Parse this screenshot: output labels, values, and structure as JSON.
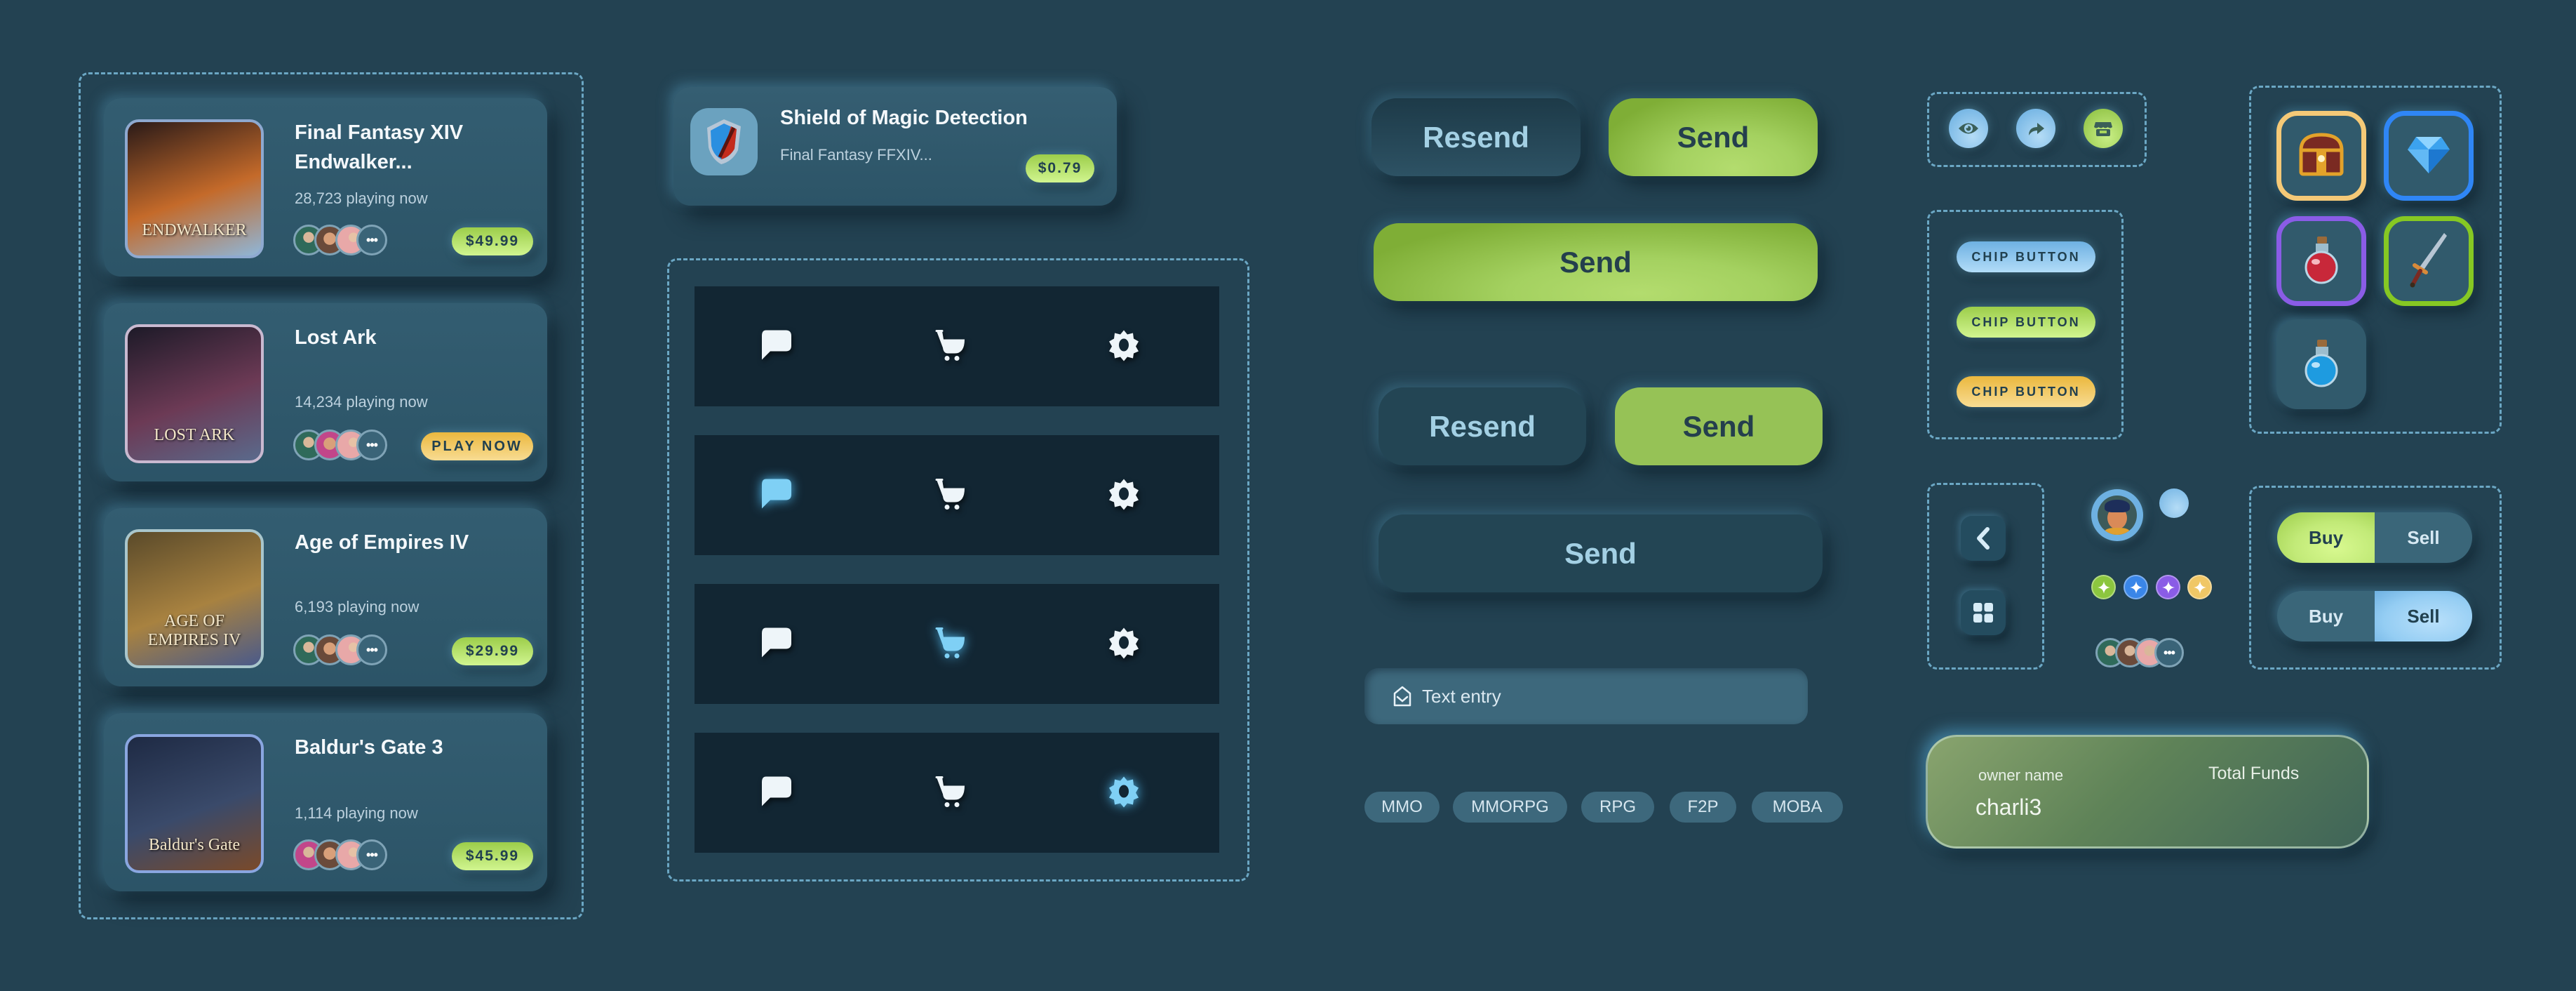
{
  "games": [
    {
      "title": "Final Fantasy XIV Endwalker...",
      "players": "28,723 playing now",
      "action": "$49.99",
      "action_type": "price",
      "thumb_caption": "ENDWALKER",
      "thumb_colors": [
        "#2a1a18",
        "#c46a2a",
        "#8fb6d8"
      ],
      "frame_color": "#8ea9d0"
    },
    {
      "title": "Lost Ark",
      "players": "14,234 playing now",
      "action": "PLAY NOW",
      "action_type": "play",
      "thumb_caption": "LOST ARK",
      "thumb_colors": [
        "#1d1a28",
        "#6c3a55",
        "#5a6a8c"
      ],
      "frame_color": "#c9b9d0"
    },
    {
      "title": "Age of Empires IV",
      "players": "6,193 playing now",
      "action": "$29.99",
      "action_type": "price",
      "thumb_caption": "AGE OF EMPIRES IV",
      "thumb_colors": [
        "#5a4a2a",
        "#a88240",
        "#4a5a8a"
      ],
      "frame_color": "#a9c6cc"
    },
    {
      "title": "Baldur's Gate 3",
      "players": "1,114 playing now",
      "action": "$45.99",
      "action_type": "price",
      "thumb_caption": "Baldur's Gate",
      "thumb_colors": [
        "#1e2a44",
        "#3a4a6a",
        "#7a4a2a"
      ],
      "frame_color": "#8aa6e0"
    }
  ],
  "item_card": {
    "title": "Shield of Magic Detection",
    "subtitle": "Final Fantasy FFXIV...",
    "price": "$0.79"
  },
  "nav_bars": {
    "icons": [
      "chat-icon",
      "cart-icon",
      "settings-icon"
    ],
    "rows_active_index": [
      null,
      0,
      1,
      2
    ],
    "active_color": "#7fd0f5",
    "inactive_color": "#eef5f9"
  },
  "buttons": {
    "resend": "Resend",
    "send": "Send"
  },
  "text_entry": {
    "placeholder": "Text entry",
    "value": ""
  },
  "tags": [
    "MMO",
    "MMORPG",
    "RPG",
    "F2P",
    "MOBA"
  ],
  "icon_buttons": [
    "eye-icon",
    "share-icon",
    "store-icon"
  ],
  "chips": [
    {
      "label": "CHIP BUTTON",
      "color": "blue"
    },
    {
      "label": "CHIP BUTTON",
      "color": "green"
    },
    {
      "label": "CHIP BUTTON",
      "color": "yellow"
    }
  ],
  "small_nav": [
    "chevron-left-icon",
    "grid-icon"
  ],
  "badges": [
    {
      "color": "#8cc63f"
    },
    {
      "color": "#3a86e8"
    },
    {
      "color": "#8a5ce6"
    },
    {
      "color": "#f0c766"
    }
  ],
  "inventory": [
    {
      "name": "treasure-chest",
      "border": "#f5c977"
    },
    {
      "name": "diamond",
      "border": "#2f86f6"
    },
    {
      "name": "red-potion",
      "border": "#8a5ce6"
    },
    {
      "name": "sword",
      "border": "#86c823"
    },
    {
      "name": "blue-potion",
      "border": null
    }
  ],
  "trade_toggles": [
    {
      "buy": "Buy",
      "sell": "Sell",
      "selected": "buy"
    },
    {
      "buy": "Buy",
      "sell": "Sell",
      "selected": "sell"
    }
  ],
  "owner_card": {
    "owner_label": "owner name",
    "owner_value": "charli3",
    "funds_label": "Total Funds"
  },
  "colors": {
    "background": "#234252",
    "accent_green": "#9ccd4a",
    "accent_blue": "#6eb1e2",
    "accent_yellow": "#ebb83e",
    "dashed_border": "#6ba7c4"
  }
}
